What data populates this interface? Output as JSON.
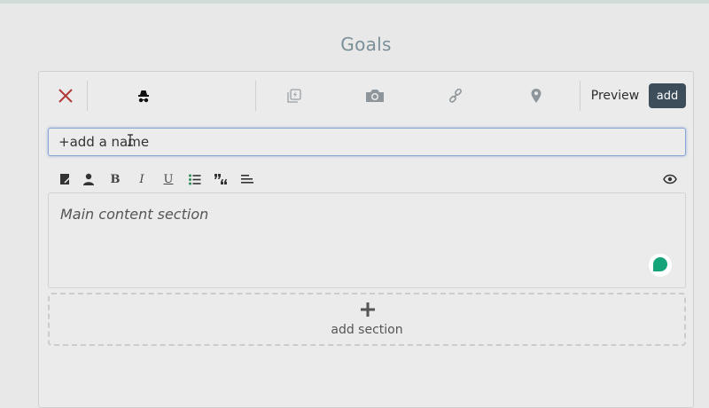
{
  "page": {
    "title": "Goals"
  },
  "toolbar": {
    "close_icon": "close-icon",
    "icons": [
      "spy-icon",
      "gif-icon",
      "camera-icon",
      "link-icon",
      "map-pin-icon"
    ],
    "preview_label": "Preview",
    "add_label": "add"
  },
  "name_field": {
    "value": "+add a name"
  },
  "format_bar": {
    "icons": [
      "notebook-icon",
      "person-icon",
      "bold-icon",
      "italic-icon",
      "underline-icon",
      "bullet-list-icon",
      "quote-icon",
      "align-left-icon",
      "eye-icon"
    ],
    "bold": "B",
    "italic": "I",
    "underline": "U"
  },
  "editor": {
    "placeholder": "Main content section"
  },
  "add_section": {
    "label": "add section"
  },
  "colors": {
    "accent_dark": "#3d4d5a",
    "title": "#7b8f98",
    "close": "#b03a3a",
    "grammarly": "#15a37a",
    "focus": "#8aa6d6"
  }
}
